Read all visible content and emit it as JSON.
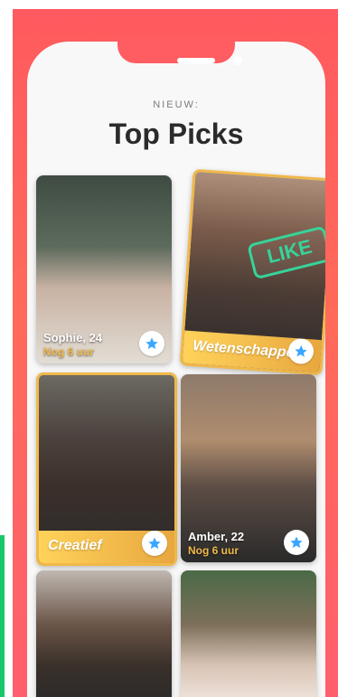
{
  "header": {
    "eyebrow": "NIEUW:",
    "title": "Top Picks"
  },
  "cards": [
    {
      "name_age": "Sophie, 24",
      "status": "Nog 6 uur",
      "icon": "star-icon"
    },
    {
      "banner": "Wetenschapper",
      "stamp": "LIKE",
      "icon": "star-icon"
    },
    {
      "banner": "Creatief",
      "icon": "star-icon"
    },
    {
      "name_age": "Amber, 22",
      "status": "Nog 6 uur",
      "icon": "star-icon"
    }
  ],
  "colors": {
    "brand_gradient_start": "#ff5a5f",
    "brand_gradient_end": "#ff5f6d",
    "star_blue": "#3aa6ff",
    "like_green": "#37d39a",
    "gold": "#f0b84a"
  }
}
